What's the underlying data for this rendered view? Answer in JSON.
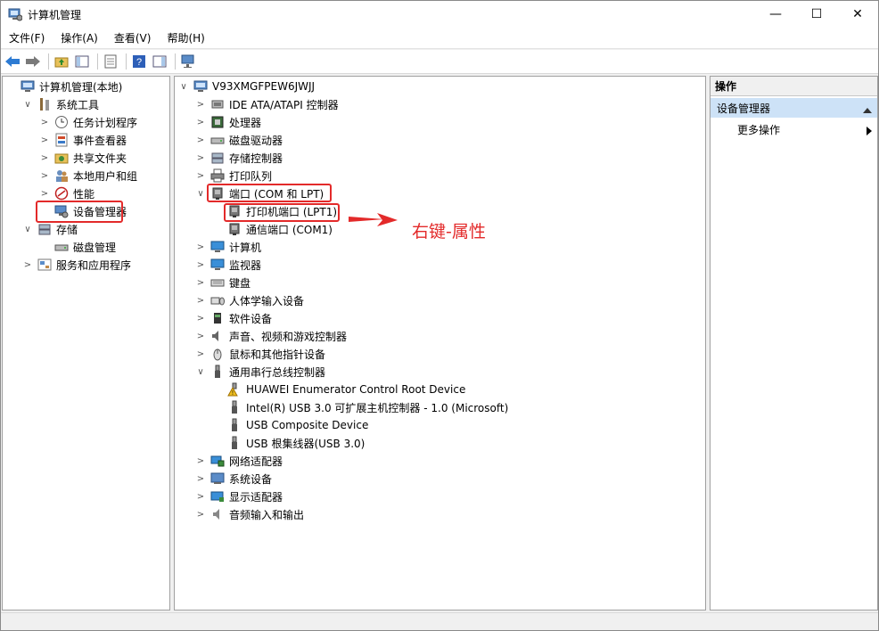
{
  "window": {
    "title": "计算机管理",
    "minimize": "—",
    "maximize": "☐",
    "close": "✕"
  },
  "menu": [
    "文件(F)",
    "操作(A)",
    "查看(V)",
    "帮助(H)"
  ],
  "left_tree": [
    {
      "label": "计算机管理(本地)",
      "expander": "",
      "indent": 0
    },
    {
      "label": "系统工具",
      "expander": "∨",
      "indent": 1
    },
    {
      "label": "任务计划程序",
      "expander": ">",
      "indent": 2
    },
    {
      "label": "事件查看器",
      "expander": ">",
      "indent": 2
    },
    {
      "label": "共享文件夹",
      "expander": ">",
      "indent": 2
    },
    {
      "label": "本地用户和组",
      "expander": ">",
      "indent": 2
    },
    {
      "label": "性能",
      "expander": ">",
      "indent": 2
    },
    {
      "label": "设备管理器",
      "expander": "",
      "indent": 2
    },
    {
      "label": "存储",
      "expander": "∨",
      "indent": 1
    },
    {
      "label": "磁盘管理",
      "expander": "",
      "indent": 2
    },
    {
      "label": "服务和应用程序",
      "expander": ">",
      "indent": 1
    }
  ],
  "device_tree": [
    {
      "label": "V93XMGFPEW6JWJJ",
      "expander": "∨",
      "indent": 0
    },
    {
      "label": "IDE ATA/ATAPI 控制器",
      "expander": ">",
      "indent": 1
    },
    {
      "label": "处理器",
      "expander": ">",
      "indent": 1
    },
    {
      "label": "磁盘驱动器",
      "expander": ">",
      "indent": 1
    },
    {
      "label": "存储控制器",
      "expander": ">",
      "indent": 1
    },
    {
      "label": "打印队列",
      "expander": ">",
      "indent": 1
    },
    {
      "label": "端口 (COM 和 LPT)",
      "expander": "∨",
      "indent": 1
    },
    {
      "label": "打印机端口 (LPT1)",
      "expander": "",
      "indent": 2
    },
    {
      "label": "通信端口 (COM1)",
      "expander": "",
      "indent": 2
    },
    {
      "label": "计算机",
      "expander": ">",
      "indent": 1
    },
    {
      "label": "监视器",
      "expander": ">",
      "indent": 1
    },
    {
      "label": "键盘",
      "expander": ">",
      "indent": 1
    },
    {
      "label": "人体学输入设备",
      "expander": ">",
      "indent": 1
    },
    {
      "label": "软件设备",
      "expander": ">",
      "indent": 1
    },
    {
      "label": "声音、视频和游戏控制器",
      "expander": ">",
      "indent": 1
    },
    {
      "label": "鼠标和其他指针设备",
      "expander": ">",
      "indent": 1
    },
    {
      "label": "通用串行总线控制器",
      "expander": "∨",
      "indent": 1
    },
    {
      "label": "HUAWEI Enumerator Control Root Device",
      "expander": "",
      "indent": 2
    },
    {
      "label": "Intel(R) USB 3.0 可扩展主机控制器 - 1.0 (Microsoft)",
      "expander": "",
      "indent": 2
    },
    {
      "label": "USB Composite Device",
      "expander": "",
      "indent": 2
    },
    {
      "label": "USB 根集线器(USB 3.0)",
      "expander": "",
      "indent": 2
    },
    {
      "label": "网络适配器",
      "expander": ">",
      "indent": 1
    },
    {
      "label": "系统设备",
      "expander": ">",
      "indent": 1
    },
    {
      "label": "显示适配器",
      "expander": ">",
      "indent": 1
    },
    {
      "label": "音频输入和输出",
      "expander": ">",
      "indent": 1
    }
  ],
  "actions": {
    "header": "操作",
    "selected": "设备管理器",
    "more": "更多操作"
  },
  "annotation": {
    "text": "右键-属性",
    "color": "#e32a2a"
  }
}
